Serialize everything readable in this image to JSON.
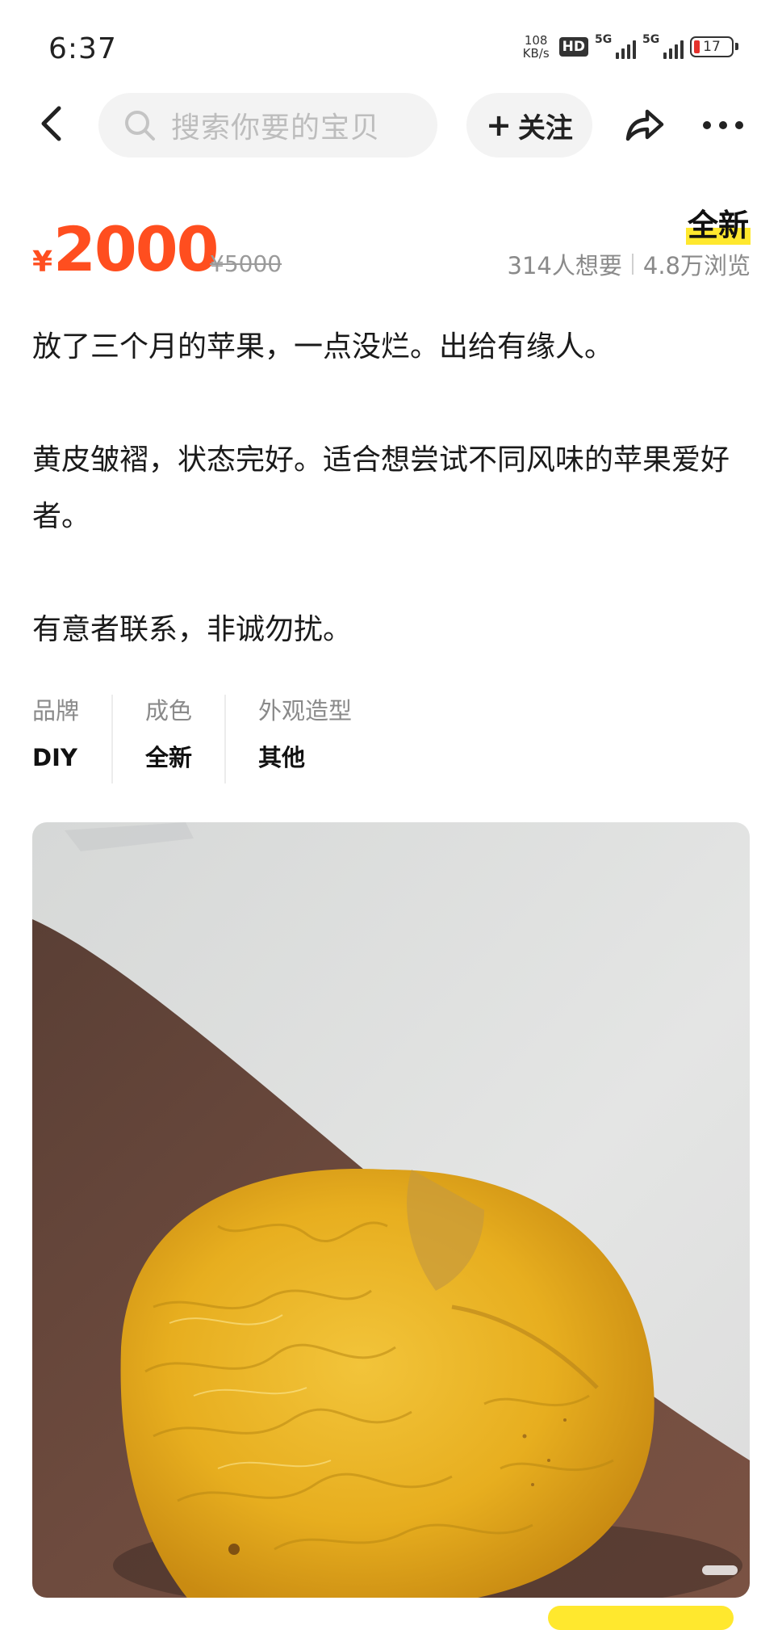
{
  "status_bar": {
    "time": "6:37",
    "net_speed_value": "108",
    "net_speed_unit": "KB/s",
    "hd_label": "HD",
    "sim1_label": "5G",
    "sim2_label": "5G",
    "battery_level": "17",
    "battery_color": "#e5322d"
  },
  "nav": {
    "search_placeholder": "搜索你要的宝贝",
    "follow_plus": "+",
    "follow_label": "关注"
  },
  "listing": {
    "currency": "¥",
    "price": "2000",
    "original_price": "¥5000",
    "condition_badge": "全新",
    "wants": "314人想要",
    "views": "4.8万浏览",
    "price_color": "#ff4e1f",
    "badge_highlight_color": "#ffe82e",
    "description": {
      "line1": "放了三个月的苹果，一点没烂。出给有缘人。",
      "line2": "黄皮皱褶，状态完好。适合想尝试不同风味的苹果爱好者。",
      "line3": "有意者联系，非诚勿扰。"
    },
    "attributes": [
      {
        "label": "品牌",
        "value": "DIY"
      },
      {
        "label": "成色",
        "value": "全新"
      },
      {
        "label": "外观造型",
        "value": "其他"
      }
    ]
  },
  "icons": {
    "back": "chevron-left-icon",
    "search": "search-icon",
    "share": "share-icon",
    "more": "more-dots-icon"
  }
}
